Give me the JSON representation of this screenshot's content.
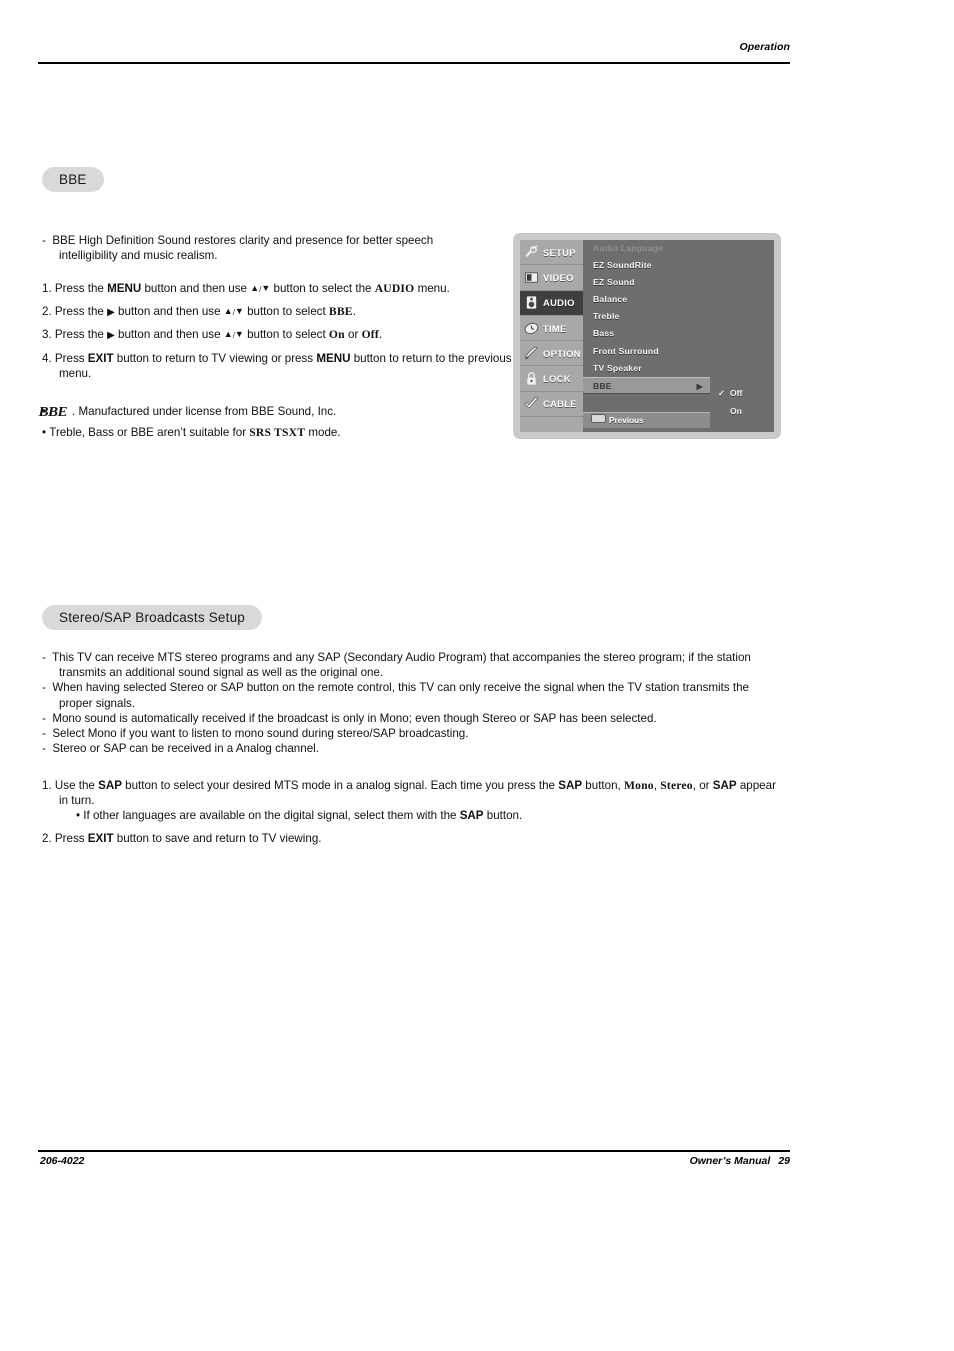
{
  "header": {
    "running_head": "Operation"
  },
  "sections": {
    "bbe": {
      "title": "BBE",
      "description": "BBE High Definition Sound restores clarity and presence for better speech intelligibility and music realism.",
      "steps": [
        {
          "num": "1.",
          "pre": "Press the ",
          "b1": "MENU",
          "mid1": " button and then use ",
          "up": "▲",
          "sep": "/",
          "down": "▼",
          "mid2": " button to select the ",
          "b2": "AUDIO",
          "post": " menu."
        },
        {
          "num": "2.",
          "pre": "Press the ",
          "rarrow": "▶",
          "mid1": " button and then use ",
          "up": "▲",
          "sep": "/",
          "down": "▼",
          "mid2": " button to select ",
          "b2": "BBE",
          "post": "."
        },
        {
          "num": "3.",
          "pre": "Press the ",
          "rarrow": "▶",
          "mid1": " button and then use ",
          "up": "▲",
          "sep": "/",
          "down": "▼",
          "mid2": " button to select ",
          "b2": "On",
          "mid3": " or ",
          "b3": "Off",
          "post": "."
        },
        {
          "num": "4.",
          "pre": "Press ",
          "b1": "EXIT",
          "mid1": " button to return to TV viewing or press ",
          "b2": "MENU",
          "post": " button to return to the previous menu."
        }
      ],
      "notes": [
        {
          "bullet": "•",
          "logo": "BBE",
          "text": ". Manufactured under license from BBE Sound, Inc."
        },
        {
          "bullet": "•",
          "pre": "Treble, Bass or BBE aren’t suitable for ",
          "trademark": "SRS TSXT",
          "post": " mode."
        }
      ]
    },
    "stereo_sap": {
      "title": "Stereo/SAP Broadcasts Setup",
      "bullets": [
        "This TV can receive MTS stereo programs and any SAP (Secondary Audio Program) that accompanies the stereo program; if the station transmits an additional sound signal as well as the original one.",
        "When having selected Stereo or SAP button on the remote control, this TV can only receive the signal when the TV station transmits the proper signals.",
        "Mono sound is automatically received if the broadcast is only in Mono; even though Stereo or SAP has been selected.",
        "Select Mono if you want to listen to mono sound during stereo/SAP broadcasting.",
        "Stereo or SAP can be received in a Analog channel."
      ],
      "steps": [
        {
          "num": "1.",
          "pre": "Use the ",
          "b1": "SAP",
          "mid1": " button to select your desired MTS mode in a analog signal. Each time you press the ",
          "b2": "SAP",
          "mid2": " button, ",
          "b3": "Mono",
          "mid3": ", ",
          "b4": "Stereo",
          "mid4": ", or ",
          "b5": "SAP",
          "post": " appear in turn.",
          "sub": {
            "bullet": "•",
            "pre": "If other languages are available on the digital signal, select them with the ",
            "b1": "SAP",
            "post": " button."
          }
        },
        {
          "num": "2.",
          "pre": "Press ",
          "b1": "EXIT",
          "post": " button to save and return to TV viewing."
        }
      ]
    }
  },
  "osd": {
    "sidebar": [
      {
        "label": "SETUP",
        "icon": "satellite-dish-icon",
        "selected": false
      },
      {
        "label": "VIDEO",
        "icon": "monitor-icon",
        "selected": false
      },
      {
        "label": "AUDIO",
        "icon": "speaker-icon",
        "selected": true
      },
      {
        "label": "TIME",
        "icon": "clock-icon",
        "selected": false
      },
      {
        "label": "OPTION",
        "icon": "wrench-icon",
        "selected": false
      },
      {
        "label": "LOCK",
        "icon": "padlock-icon",
        "selected": false
      },
      {
        "label": "CABLE",
        "icon": "check-icon",
        "selected": false
      }
    ],
    "menu_items": [
      {
        "label": "Audio Language",
        "state": "disabled"
      },
      {
        "label": "EZ SoundRite",
        "state": "normal"
      },
      {
        "label": "EZ Sound",
        "state": "normal"
      },
      {
        "label": "Balance",
        "state": "normal"
      },
      {
        "label": "Treble",
        "state": "normal"
      },
      {
        "label": "Bass",
        "state": "normal"
      },
      {
        "label": "Front Surround",
        "state": "normal"
      },
      {
        "label": "TV Speaker",
        "state": "normal"
      },
      {
        "label": "BBE",
        "state": "highlighted",
        "chevron": "▶"
      }
    ],
    "previous": {
      "label": "Previous"
    },
    "submenu": [
      {
        "label": "Off",
        "checked": true,
        "check": "✓"
      },
      {
        "label": "On",
        "checked": false
      }
    ]
  },
  "footer": {
    "doc_number": "206-4022",
    "manual_label": "Owner’s Manual",
    "page_number": "29"
  }
}
